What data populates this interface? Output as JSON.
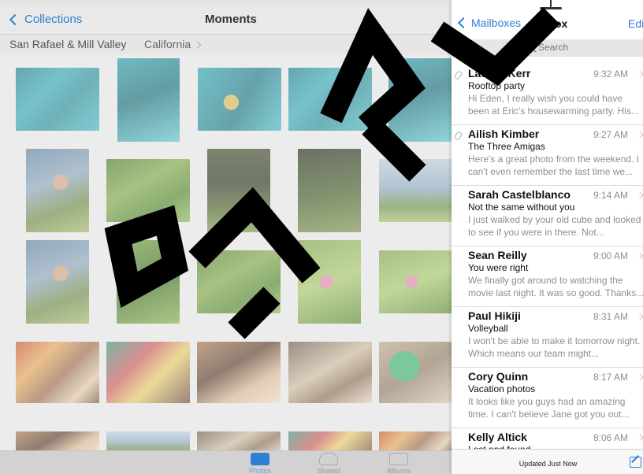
{
  "photos_app": {
    "back_label": "Collections",
    "title": "Moments",
    "location": "San Rafael & Mill Valley",
    "region": "California",
    "tabs": [
      {
        "label": "Photos"
      },
      {
        "label": "Shared"
      },
      {
        "label": "Albums"
      }
    ],
    "accent_color": "#2f7fd6"
  },
  "mail": {
    "back_label": "Mailboxes",
    "title": "Inbox",
    "edit_label": "Edi",
    "search_placeholder": "Search",
    "status": "Updated Just Now",
    "messages": [
      {
        "sender": "Lauren Kerr",
        "time": "9:32 AM",
        "subject": "Rooftop party",
        "preview": "Hi Eden, I really wish you could have been at Eric's housewarming party. His...",
        "attachment": true
      },
      {
        "sender": "Ailish Kimber",
        "time": "9:27 AM",
        "subject": "The Three Amigas",
        "preview": "Here's a great photo from the weekend. I can't even remember the last time we...",
        "attachment": true
      },
      {
        "sender": "Sarah Castelblanco",
        "time": "9:14 AM",
        "subject": "Not the same without you",
        "preview": "I just walked by your old cube and looked to see if you were in there. Not...",
        "attachment": false
      },
      {
        "sender": "Sean Reilly",
        "time": "9:00 AM",
        "subject": "You were right",
        "preview": "We finally got around to watching the movie last night. It was so good. Thanks...",
        "attachment": false
      },
      {
        "sender": "Paul Hikiji",
        "time": "8:31 AM",
        "subject": "Volleyball",
        "preview": "I won't be able to make it tomorrow night. Which means our team might...",
        "attachment": false
      },
      {
        "sender": "Cory Quinn",
        "time": "8:17 AM",
        "subject": "Vacation photos",
        "preview": "It looks like you guys had an amazing time. I can't believe Jane got you out...",
        "attachment": false
      },
      {
        "sender": "Kelly Altick",
        "time": "8:06 AM",
        "subject": "Lost and found",
        "preview": "",
        "attachment": false
      }
    ]
  }
}
